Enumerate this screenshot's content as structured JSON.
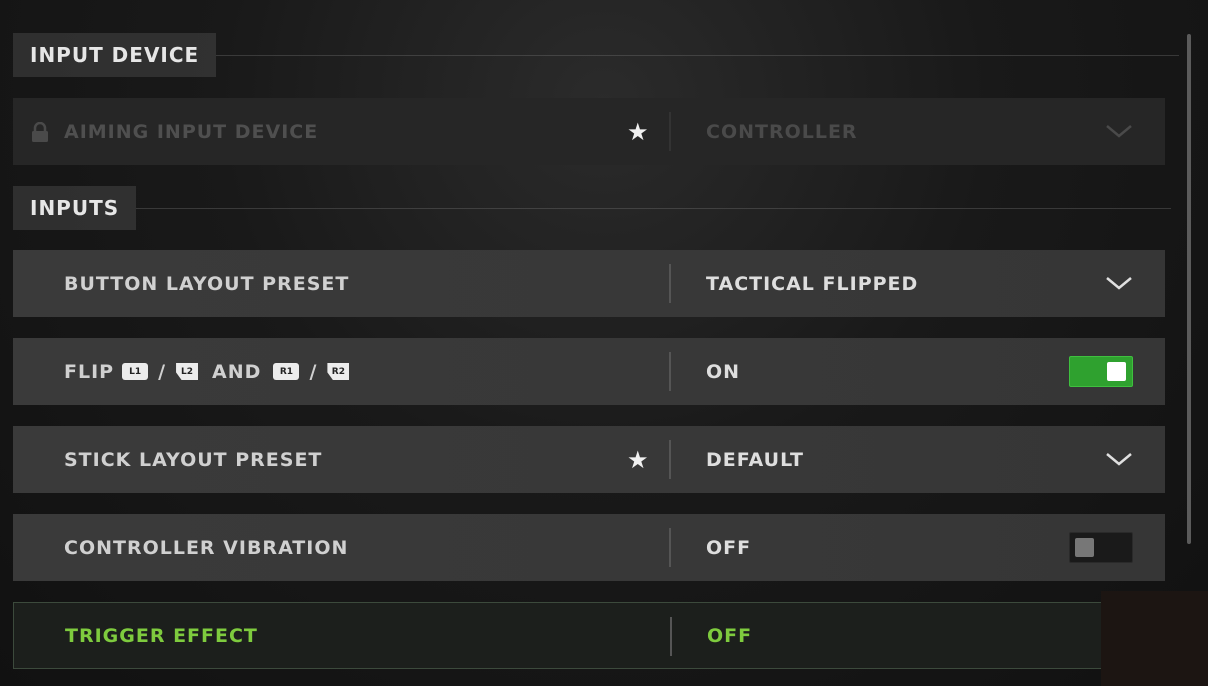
{
  "sections": {
    "input_device": "INPUT DEVICE",
    "inputs": "INPUTS"
  },
  "settings": {
    "aiming_input_device": {
      "label": "AIMING INPUT DEVICE",
      "value": "CONTROLLER",
      "locked": true,
      "starred": true
    },
    "button_layout_preset": {
      "label": "BUTTON LAYOUT PRESET",
      "value": "TACTICAL FLIPPED"
    },
    "flip_triggers": {
      "label_prefix": "FLIP",
      "l1": "L1",
      "slash1": "/",
      "l2": "L2",
      "and_text": "AND",
      "r1": "R1",
      "slash2": "/",
      "r2": "R2",
      "value": "ON",
      "toggle": "on"
    },
    "stick_layout_preset": {
      "label": "STICK LAYOUT PRESET",
      "value": "DEFAULT",
      "starred": true
    },
    "controller_vibration": {
      "label": "CONTROLLER VIBRATION",
      "value": "OFF",
      "toggle": "off"
    },
    "trigger_effect": {
      "label": "TRIGGER EFFECT",
      "value": "OFF"
    }
  },
  "icons": {
    "lock": "lock-icon",
    "star": "★",
    "chevron": "chevron-down-icon",
    "toggle": "toggle-switch"
  },
  "colors": {
    "accent_green": "#7ecb3e",
    "toggle_on": "#2fa12f"
  }
}
